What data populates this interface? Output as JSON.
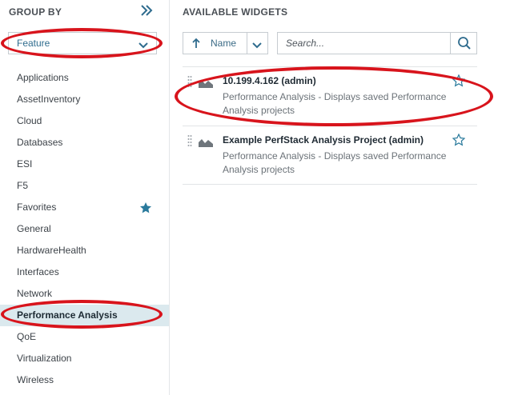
{
  "group_by": {
    "title": "GROUP BY",
    "dropdown_value": "Feature",
    "items": [
      {
        "label": "Applications"
      },
      {
        "label": "AssetInventory"
      },
      {
        "label": "Cloud"
      },
      {
        "label": "Databases"
      },
      {
        "label": "ESI"
      },
      {
        "label": "F5"
      },
      {
        "label": "Favorites",
        "icon": "star-filled-icon"
      },
      {
        "label": "General"
      },
      {
        "label": "HardwareHealth"
      },
      {
        "label": "Interfaces"
      },
      {
        "label": "Network"
      },
      {
        "label": "Performance Analysis",
        "selected": true
      },
      {
        "label": "QoE"
      },
      {
        "label": "Virtualization"
      },
      {
        "label": "Wireless"
      }
    ]
  },
  "available_widgets": {
    "title": "AVAILABLE WIDGETS",
    "sort_label": "Name",
    "search_placeholder": "Search...",
    "widgets": [
      {
        "title": "10.199.4.162 (admin)",
        "description": "Performance Analysis - Displays saved Performance Analysis projects"
      },
      {
        "title": "Example PerfStack Analysis Project (admin)",
        "description": "Performance Analysis - Displays saved Performance Analysis projects"
      }
    ]
  },
  "colors": {
    "accent": "#2f6c8e",
    "selected_bg": "#dbe9ee",
    "annotation": "#d8141c",
    "favorite_star": "#2a7a9c"
  }
}
